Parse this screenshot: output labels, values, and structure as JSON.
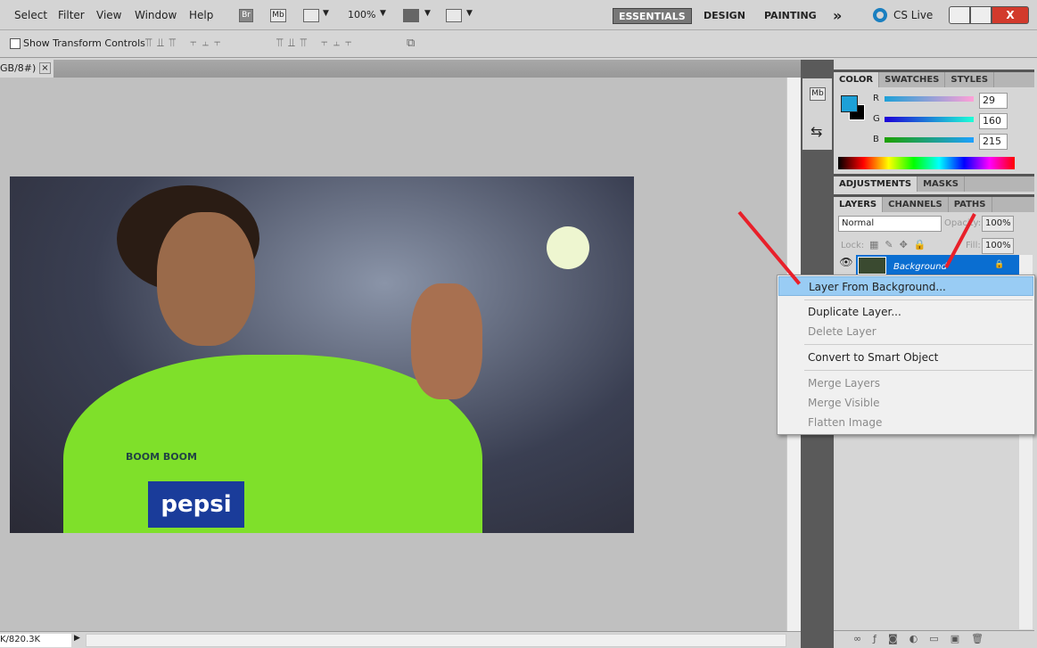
{
  "menubar": {
    "items": [
      "Select",
      "Filter",
      "View",
      "Window",
      "Help"
    ],
    "bridge": "Br",
    "minibridge": "Mb",
    "zoom": "100%",
    "workspaces": [
      "ESSENTIALS",
      "DESIGN",
      "PAINTING"
    ],
    "more": "»",
    "cslive": "CS Live"
  },
  "options": {
    "show_transform": "Show Transform Controls",
    "checked": false
  },
  "document": {
    "tab_label": "GB/8#)",
    "close": "×"
  },
  "status": {
    "doc_size": "K/820.3K"
  },
  "color_panel": {
    "tabs": [
      "COLOR",
      "SWATCHES",
      "STYLES"
    ],
    "r": "29",
    "g": "160",
    "b": "215",
    "r_label": "R",
    "g_label": "G",
    "b_label": "B",
    "foreground": "#1da0d7",
    "background": "#000000"
  },
  "adjust_panel": {
    "tabs": [
      "ADJUSTMENTS",
      "MASKS"
    ]
  },
  "layers_panel": {
    "tabs": [
      "LAYERS",
      "CHANNELS",
      "PATHS"
    ],
    "blend_mode": "Normal",
    "opacity_label": "Opacity:",
    "opacity": "100%",
    "lock_label": "Lock:",
    "fill_label": "Fill:",
    "fill": "100%",
    "layer_name": "Background"
  },
  "context_menu": {
    "items": [
      {
        "label": "Layer From Background...",
        "state": "highlighted"
      },
      {
        "label": "Duplicate Layer...",
        "state": "enabled"
      },
      {
        "label": "Delete Layer",
        "state": "disabled"
      },
      {
        "label": "Convert to Smart Object",
        "state": "enabled"
      },
      {
        "label": "Merge Layers",
        "state": "disabled"
      },
      {
        "label": "Merge Visible",
        "state": "disabled"
      },
      {
        "label": "Flatten Image",
        "state": "disabled"
      }
    ]
  },
  "annotation_color": "#e8202a",
  "photo": {
    "shirt_text": "pepsi",
    "sponsor": "BOOM BOOM"
  }
}
